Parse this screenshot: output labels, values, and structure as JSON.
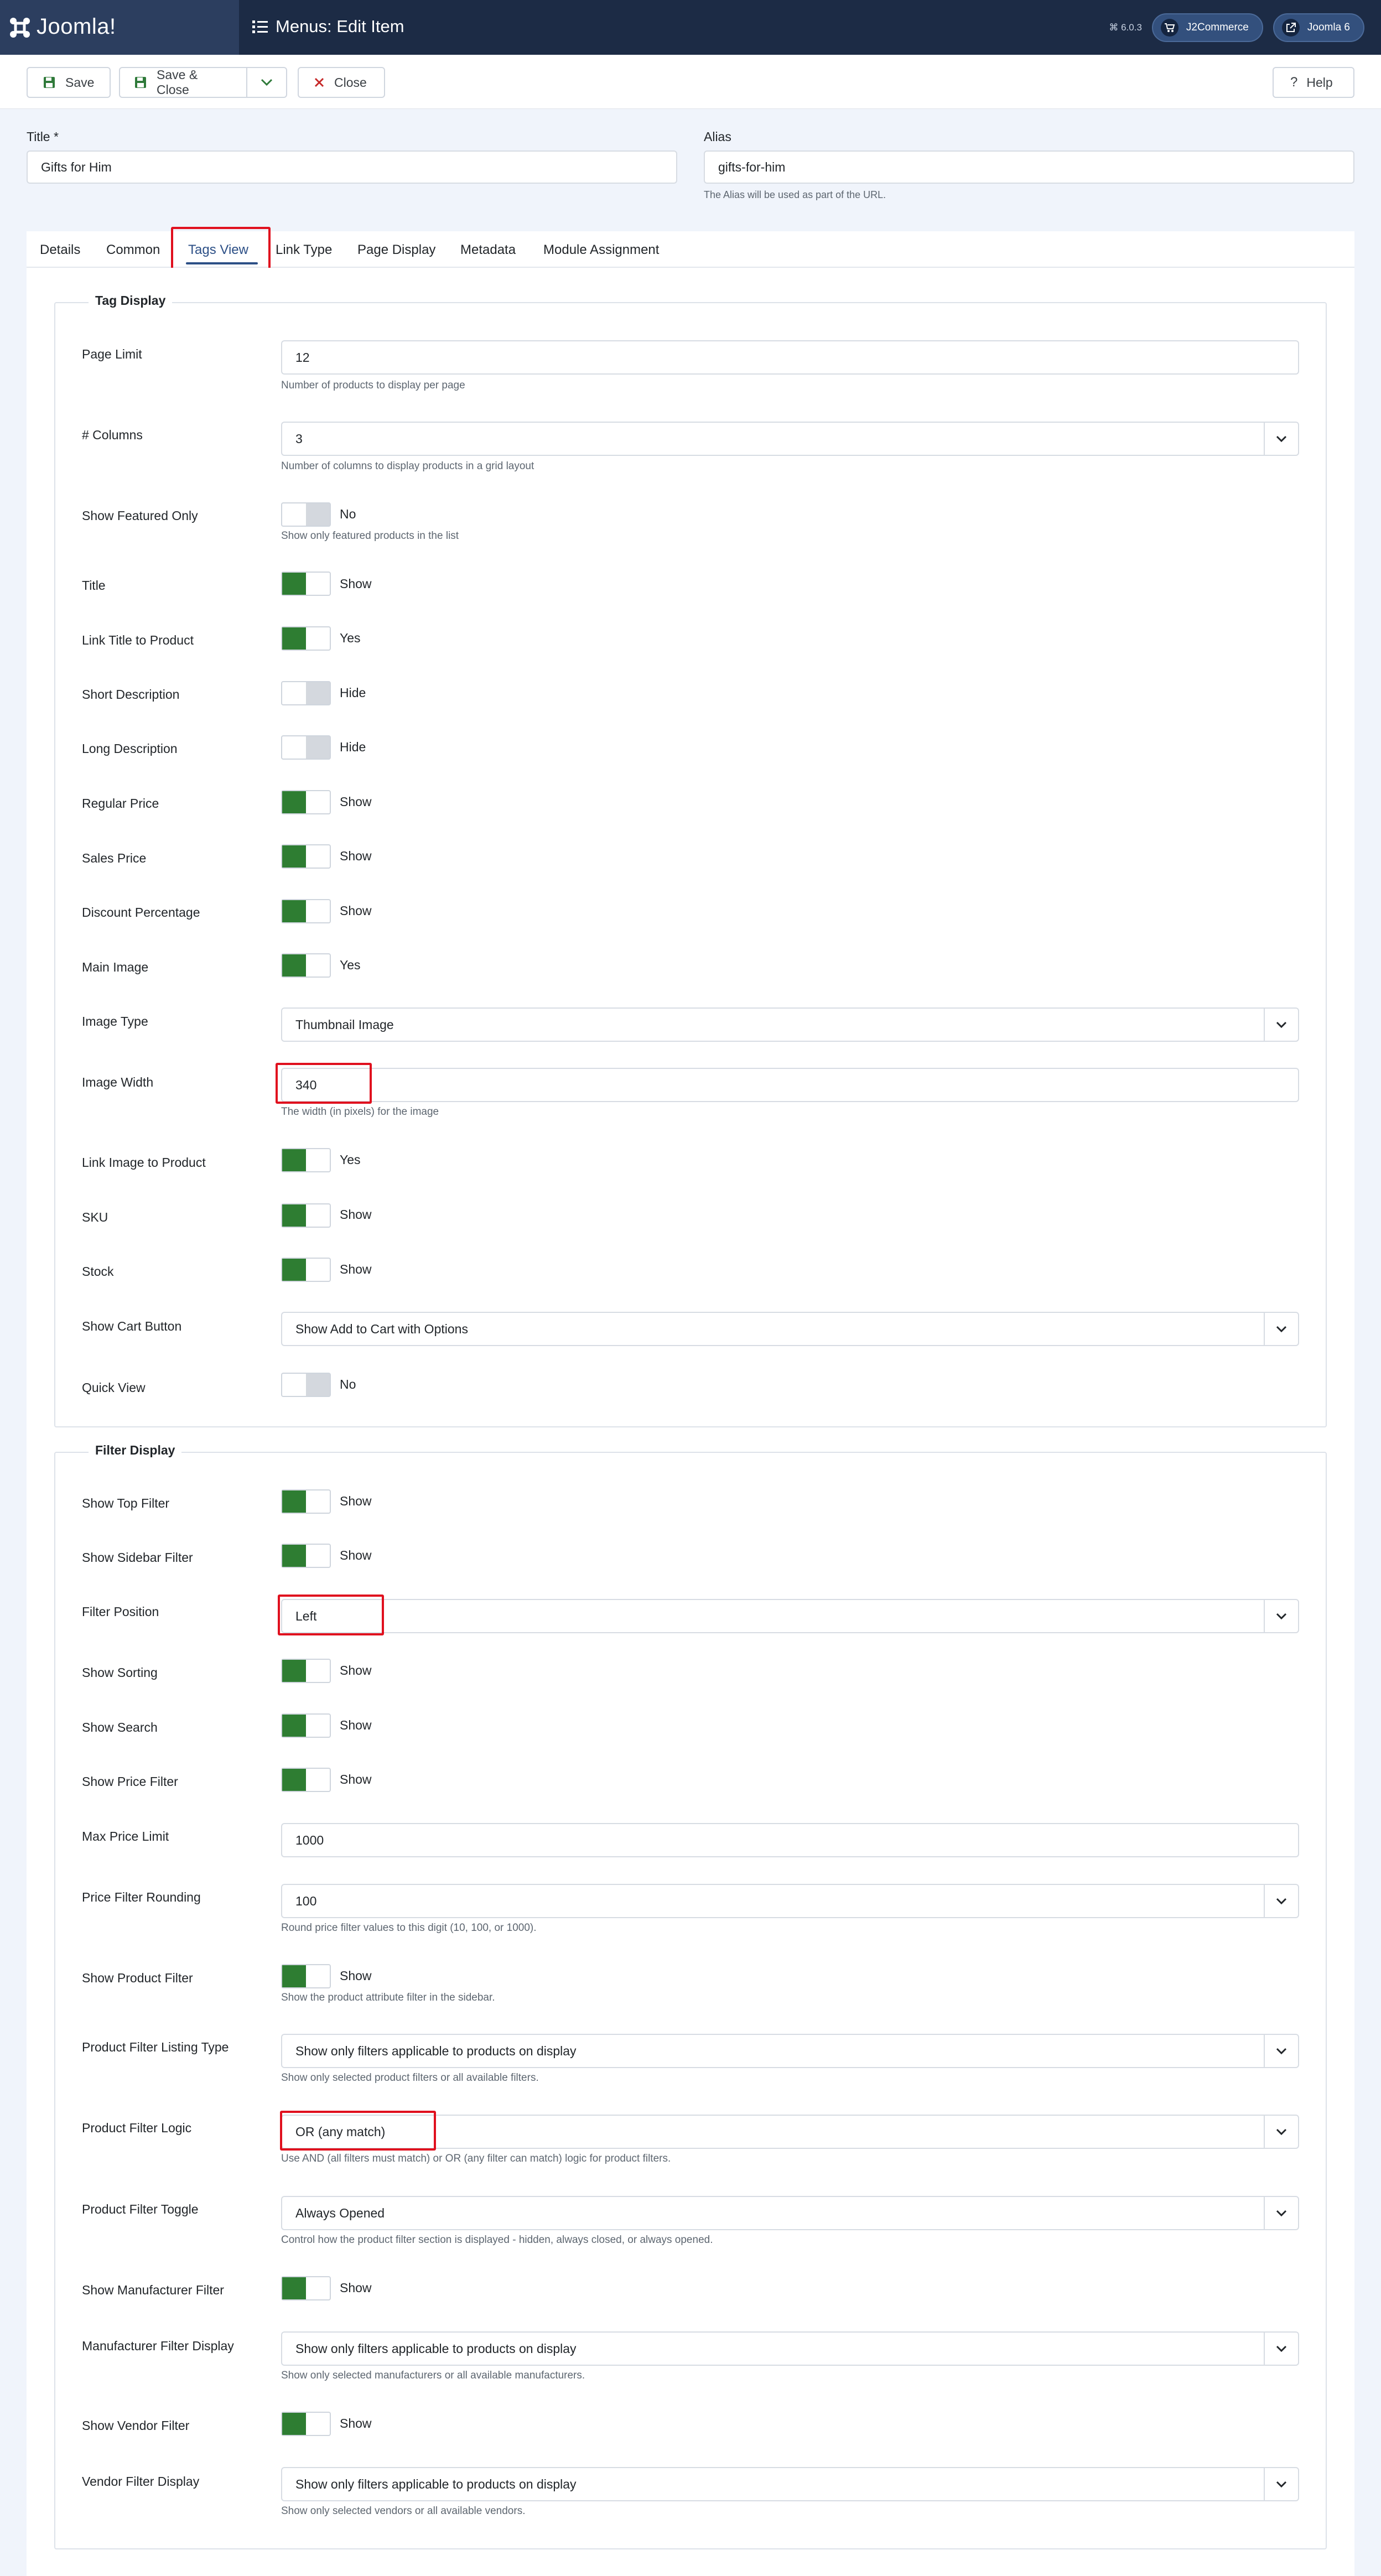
{
  "header": {
    "logo_text": "Joomla!",
    "page_title": "Menus: Edit Item",
    "version": "⌘ 6.0.3",
    "btn_j2commerce": "J2Commerce",
    "btn_joomla": "Joomla 6"
  },
  "toolbar": {
    "save": "Save",
    "save_close": "Save & Close",
    "close": "Close",
    "help": "Help"
  },
  "form": {
    "title_label": "Title *",
    "title_value": "Gifts for Him",
    "alias_label": "Alias",
    "alias_value": "gifts-for-him",
    "alias_hint": "The Alias will be used as part of the URL."
  },
  "tabs": [
    "Details",
    "Common",
    "Tags View",
    "Link Type",
    "Page Display",
    "Metadata",
    "Module Assignment"
  ],
  "tag_display": {
    "legend": "Tag Display",
    "page_limit": {
      "label": "Page Limit",
      "value": "12",
      "hint": "Number of products to display per page"
    },
    "columns": {
      "label": "# Columns",
      "value": "3",
      "hint": "Number of columns to display products in a grid layout"
    },
    "featured_only": {
      "label": "Show Featured Only",
      "value": "No",
      "hint": "Show only featured products in the list"
    },
    "title": {
      "label": "Title",
      "value": "Show"
    },
    "link_title": {
      "label": "Link Title to Product",
      "value": "Yes"
    },
    "short_desc": {
      "label": "Short Description",
      "value": "Hide"
    },
    "long_desc": {
      "label": "Long Description",
      "value": "Hide"
    },
    "regular_price": {
      "label": "Regular Price",
      "value": "Show"
    },
    "sales_price": {
      "label": "Sales Price",
      "value": "Show"
    },
    "discount_pct": {
      "label": "Discount Percentage",
      "value": "Show"
    },
    "main_image": {
      "label": "Main Image",
      "value": "Yes"
    },
    "image_type": {
      "label": "Image Type",
      "value": "Thumbnail Image"
    },
    "image_width": {
      "label": "Image Width",
      "value": "340",
      "hint": "The width (in pixels) for the image"
    },
    "link_image": {
      "label": "Link Image to Product",
      "value": "Yes"
    },
    "sku": {
      "label": "SKU",
      "value": "Show"
    },
    "stock": {
      "label": "Stock",
      "value": "Show"
    },
    "cart_button": {
      "label": "Show Cart Button",
      "value": "Show Add to Cart with Options"
    },
    "quick_view": {
      "label": "Quick View",
      "value": "No"
    }
  },
  "filter_display": {
    "legend": "Filter Display",
    "top_filter": {
      "label": "Show Top Filter",
      "value": "Show"
    },
    "sidebar_filter": {
      "label": "Show Sidebar Filter",
      "value": "Show"
    },
    "filter_position": {
      "label": "Filter Position",
      "value": "Left"
    },
    "sorting": {
      "label": "Show Sorting",
      "value": "Show"
    },
    "search": {
      "label": "Show Search",
      "value": "Show"
    },
    "price_filter": {
      "label": "Show Price Filter",
      "value": "Show"
    },
    "max_price": {
      "label": "Max Price Limit",
      "value": "1000"
    },
    "price_rounding": {
      "label": "Price Filter Rounding",
      "value": "100",
      "hint": "Round price filter values to this digit (10, 100, or 1000)."
    },
    "product_filter": {
      "label": "Show Product Filter",
      "value": "Show",
      "hint": "Show the product attribute filter in the sidebar."
    },
    "pf_listing_type": {
      "label": "Product Filter Listing Type",
      "value": "Show only filters applicable to products on display",
      "hint": "Show only selected product filters or all available filters."
    },
    "pf_logic": {
      "label": "Product Filter Logic",
      "value": "OR (any match)",
      "hint": "Use AND (all filters must match) or OR (any filter can match) logic for product filters."
    },
    "pf_toggle": {
      "label": "Product Filter Toggle",
      "value": "Always Opened",
      "hint": "Control how the product filter section is displayed - hidden, always closed, or always opened."
    },
    "manufacturer_filter": {
      "label": "Show Manufacturer Filter",
      "value": "Show"
    },
    "manufacturer_display": {
      "label": "Manufacturer Filter Display",
      "value": "Show only filters applicable to products on display",
      "hint": "Show only selected manufacturers or all available manufacturers."
    },
    "vendor_filter": {
      "label": "Show Vendor Filter",
      "value": "Show"
    },
    "vendor_display": {
      "label": "Vendor Filter Display",
      "value": "Show only filters applicable to products on display",
      "hint": "Show only selected vendors or all available vendors."
    }
  }
}
